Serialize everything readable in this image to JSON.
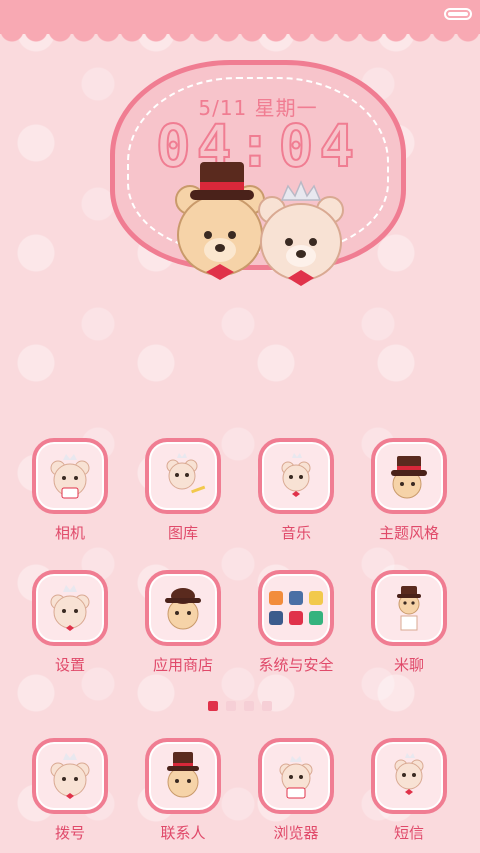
{
  "clock": {
    "date": "5/11  星期一",
    "time": "04:04"
  },
  "apps": [
    {
      "label": "相机"
    },
    {
      "label": "图库"
    },
    {
      "label": "音乐"
    },
    {
      "label": "主题风格"
    },
    {
      "label": "设置"
    },
    {
      "label": "应用商店"
    },
    {
      "label": "系统与安全"
    },
    {
      "label": "米聊"
    }
  ],
  "dock": [
    {
      "label": "拨号"
    },
    {
      "label": "联系人"
    },
    {
      "label": "浏览器"
    },
    {
      "label": "短信"
    }
  ],
  "pages": {
    "total": 4,
    "active": 1
  },
  "colors": {
    "accent": "#f07d92",
    "label": "#e04a6a",
    "active_dot": "#e0324a"
  }
}
